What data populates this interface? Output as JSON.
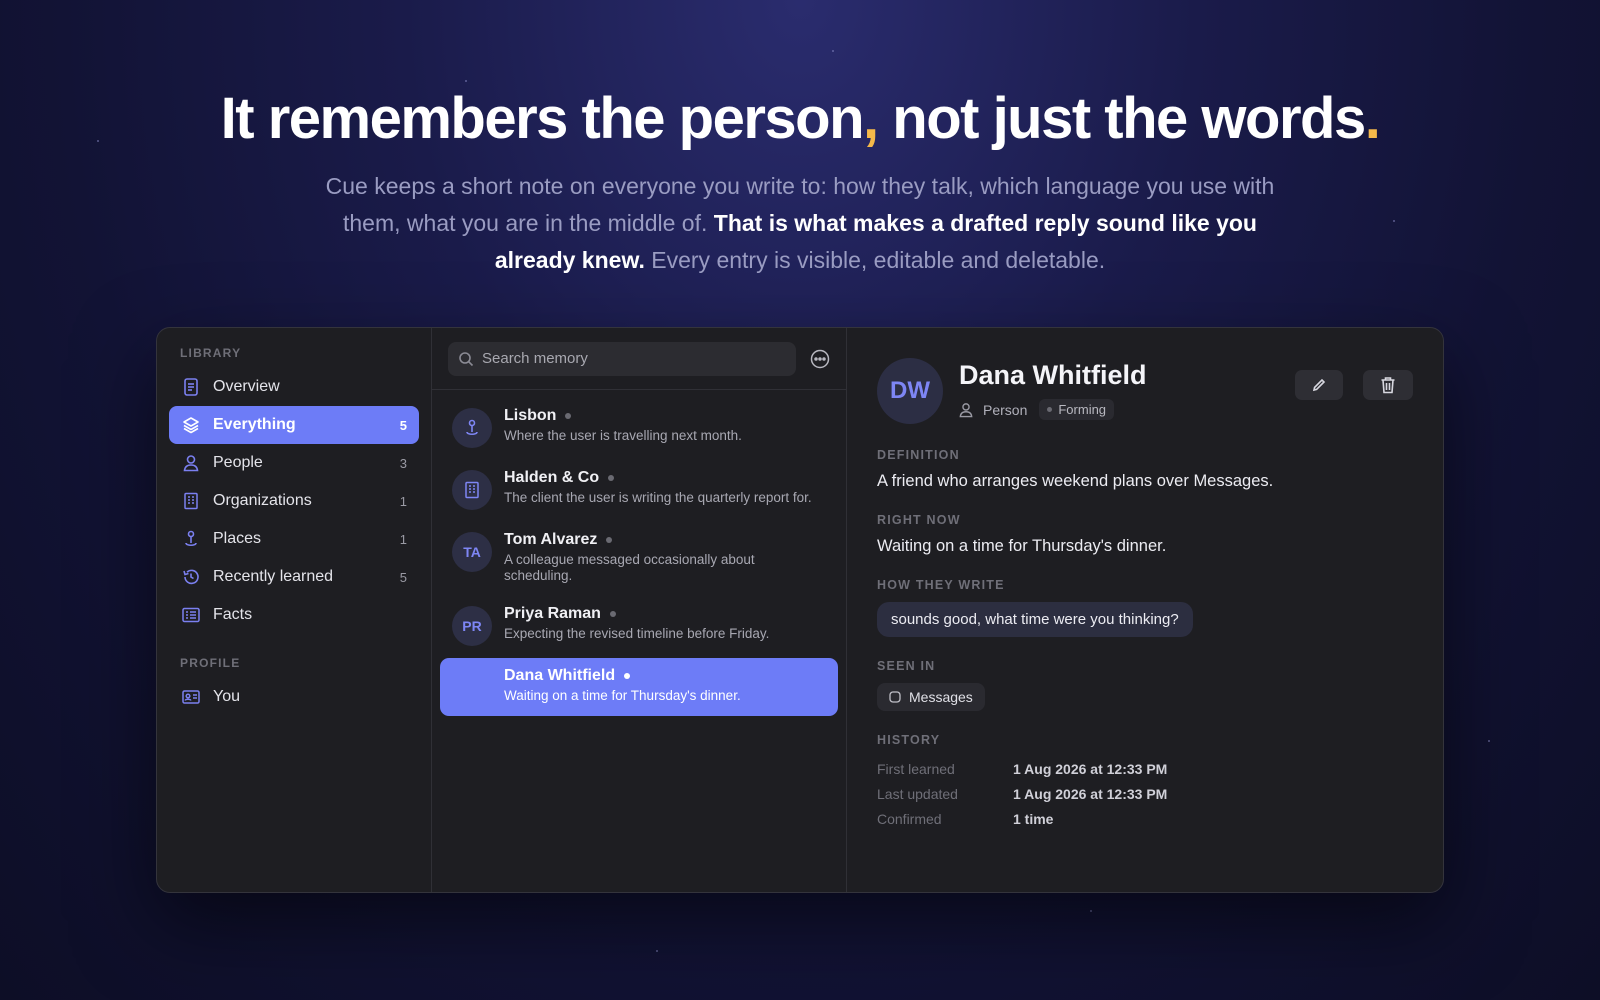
{
  "hero": {
    "headline_a": "It remembers the person",
    "headline_comma": ",",
    "headline_b": " not just the words",
    "headline_period": ".",
    "sub_a": "Cue keeps a short note on everyone you write to: how they talk, which language you use with them, what you are in the middle of. ",
    "sub_bold": "That is what makes a drafted reply sound like you already knew.",
    "sub_c": " Every entry is visible, editable and deletable."
  },
  "colors": {
    "accent": "#6d7cf7",
    "highlight": "#f5b94a"
  },
  "sidebar": {
    "library_label": "LIBRARY",
    "profile_label": "PROFILE",
    "items": [
      {
        "label": "Overview",
        "count": "",
        "icon": "document-icon"
      },
      {
        "label": "Everything",
        "count": "5",
        "icon": "layers-icon"
      },
      {
        "label": "People",
        "count": "3",
        "icon": "person-icon"
      },
      {
        "label": "Organizations",
        "count": "1",
        "icon": "building-icon"
      },
      {
        "label": "Places",
        "count": "1",
        "icon": "pin-icon"
      },
      {
        "label": "Recently learned",
        "count": "5",
        "icon": "history-icon"
      },
      {
        "label": "Facts",
        "count": "",
        "icon": "list-icon"
      }
    ],
    "profile_items": [
      {
        "label": "You",
        "icon": "id-card-icon"
      }
    ]
  },
  "list": {
    "search_placeholder": "Search memory",
    "entries": [
      {
        "initials": "",
        "icon": "pin-icon",
        "name": "Lisbon",
        "desc": "Where the user is travelling next month."
      },
      {
        "initials": "",
        "icon": "building-icon",
        "name": "Halden & Co",
        "desc": "The client the user is writing the quarterly report for."
      },
      {
        "initials": "TA",
        "name": "Tom Alvarez",
        "desc": "A colleague messaged occasionally about scheduling."
      },
      {
        "initials": "PR",
        "name": "Priya Raman",
        "desc": "Expecting the revised timeline before Friday."
      },
      {
        "initials": "DW",
        "name": "Dana Whitfield",
        "desc": "Waiting on a time for Thursday's dinner."
      }
    ]
  },
  "detail": {
    "initials": "DW",
    "name": "Dana Whitfield",
    "type": "Person",
    "status": "Forming",
    "definition_label": "DEFINITION",
    "definition": "A friend who arranges weekend plans over Messages.",
    "right_now_label": "RIGHT NOW",
    "right_now": "Waiting on a time for Thursday's dinner.",
    "how_label": "HOW THEY WRITE",
    "how_quote": "sounds good, what time were you thinking?",
    "seen_label": "SEEN IN",
    "seen_in": "Messages",
    "history_label": "HISTORY",
    "history": [
      {
        "k": "First learned",
        "v": "1 Aug 2026 at 12:33 PM"
      },
      {
        "k": "Last updated",
        "v": "1 Aug 2026 at 12:33 PM"
      },
      {
        "k": "Confirmed",
        "v": "1 time"
      }
    ]
  }
}
